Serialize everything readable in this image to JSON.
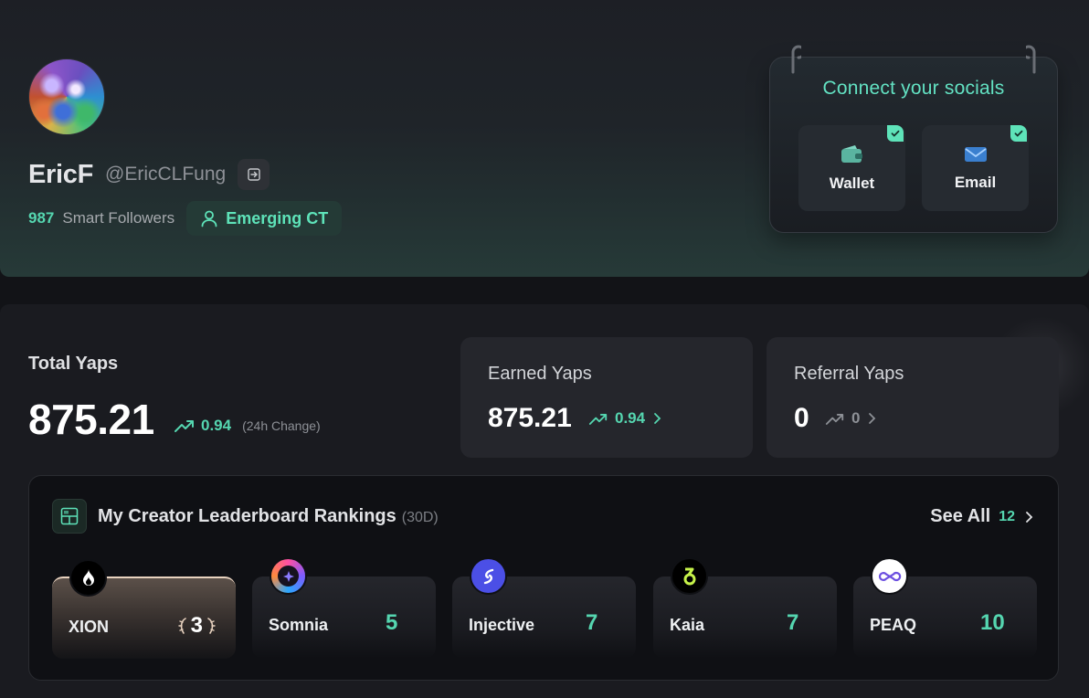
{
  "profile": {
    "display_name": "EricF",
    "handle": "@EricCLFung",
    "smart_followers_count": "987",
    "smart_followers_label": "Smart Followers",
    "badge_label": "Emerging CT"
  },
  "socials": {
    "title": "Connect your socials",
    "items": [
      {
        "label": "Wallet",
        "icon": "wallet-icon",
        "connected": true
      },
      {
        "label": "Email",
        "icon": "email-icon",
        "connected": true
      }
    ]
  },
  "stats": {
    "total_label": "Total Yaps",
    "total_value": "875.21",
    "total_change": "0.94",
    "total_change_note": "(24h Change)",
    "cards": [
      {
        "title": "Earned Yaps",
        "value": "875.21",
        "change": "0.94",
        "trend_color": "#55d6b0"
      },
      {
        "title": "Referral Yaps",
        "value": "0",
        "change": "0",
        "trend_color": "#8d9096"
      }
    ]
  },
  "leaderboard": {
    "title": "My Creator Leaderboard Rankings",
    "period": "(30D)",
    "see_all_label": "See All",
    "see_all_count": "12",
    "rankings": [
      {
        "name": "XION",
        "rank": "3",
        "logo": "xion-logo"
      },
      {
        "name": "Somnia",
        "rank": "5",
        "logo": "somnia-logo"
      },
      {
        "name": "Injective",
        "rank": "7",
        "logo": "injective-logo"
      },
      {
        "name": "Kaia",
        "rank": "7",
        "logo": "kaia-logo"
      },
      {
        "name": "PEAQ",
        "rank": "10",
        "logo": "peaq-logo"
      }
    ]
  },
  "colors": {
    "accent": "#55d6b0",
    "accent_bright": "#5ee3b9",
    "background": "#121317",
    "card": "#25262c"
  }
}
